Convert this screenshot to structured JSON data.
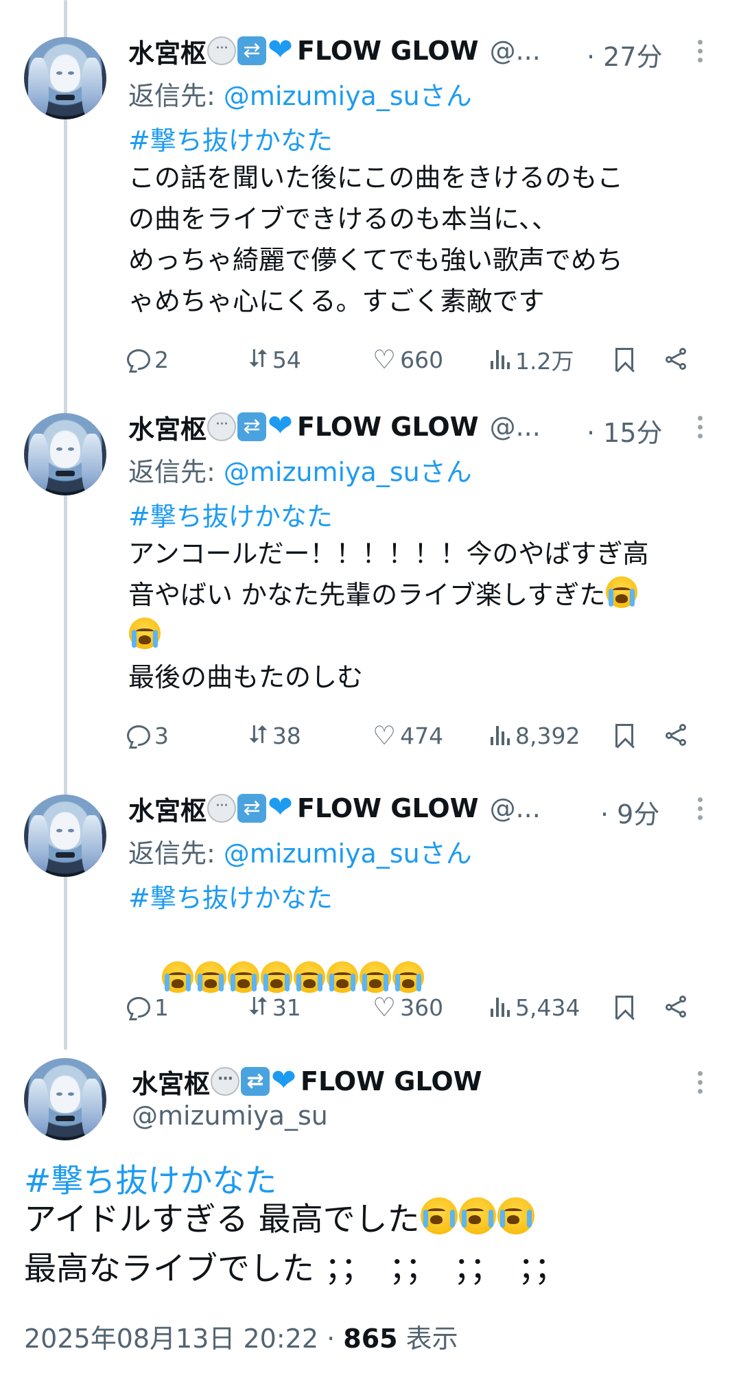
{
  "user": {
    "name": "水宮枢",
    "name_tail": "FLOW GLOW",
    "handle_short": "@...",
    "handle": "@mizumiya_su"
  },
  "replies": [
    {
      "time": "· 27分",
      "reply_to_prefix": "返信先: ",
      "reply_to_mention": "@mizumiya_suさん",
      "hashtag": "#撃ち抜けかなた",
      "lines": [
        "この話を聞いた後にこの曲をきけるのもこ",
        "の曲をライブできけるのも本当に、、",
        "めっちゃ綺麗で儚くてでも強い歌声でめち",
        "ゃめちゃ心にくる。すごく素敵です"
      ],
      "replies": "2",
      "reposts": "54",
      "likes": "660",
      "views": "1.2万"
    },
    {
      "time": "· 15分",
      "reply_to_prefix": "返信先: ",
      "reply_to_mention": "@mizumiya_suさん",
      "hashtag": "#撃ち抜けかなた",
      "lines": [
        "アンコールだー！！！！！！今のやばすぎ高",
        "音やばい かなた先輩のライブ楽しすぎた",
        "",
        "最後の曲もたのしむ"
      ],
      "replies": "3",
      "reposts": "38",
      "likes": "474",
      "views": "8,392"
    },
    {
      "time": "· 9分",
      "reply_to_prefix": "返信先: ",
      "reply_to_mention": "@mizumiya_suさん",
      "hashtag": "#撃ち抜けかなた",
      "lines": [],
      "replies": "1",
      "reposts": "31",
      "likes": "360",
      "views": "5,434"
    }
  ],
  "main_tweet": {
    "hashtag": "#撃ち抜けかなた",
    "line1": "アイドルすぎる 最高でした",
    "line2": "最高なライブでした ；；　；；　；；　；；",
    "timestamp": "2025年08月13日 20:22 · ",
    "views_count": "865",
    "views_label": " 表示"
  },
  "icons": {
    "reply": "reply-icon",
    "repost": "repost-icon",
    "like": "like-icon",
    "views": "views-icon",
    "bookmark": "bookmark-icon",
    "share": "share-icon",
    "more": "more-icon",
    "emoji_name": [
      "speech-bubble-emoji",
      "repeat-emoji",
      "blue-heart-emoji"
    ],
    "crying": "loudly-crying-face-emoji"
  },
  "colors": {
    "accent": "#1d9bf0",
    "secondary_text": "#536471",
    "thread_line": "#cfd9de"
  }
}
